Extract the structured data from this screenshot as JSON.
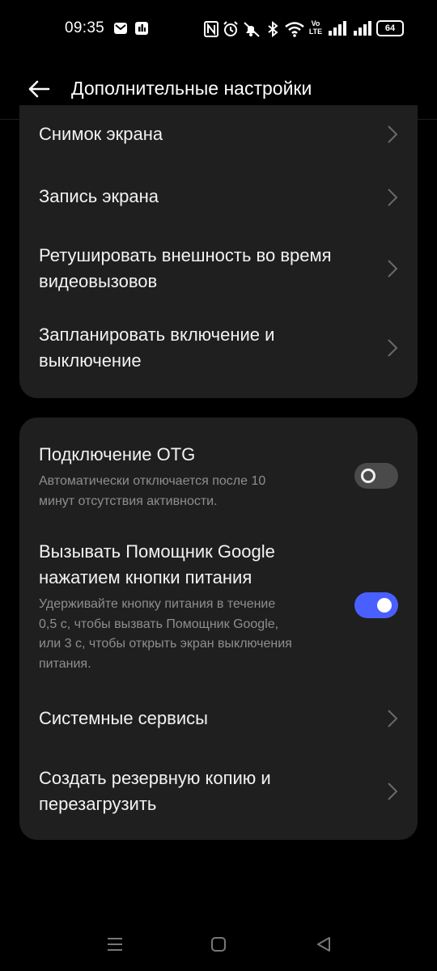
{
  "status_bar": {
    "time": "09:35",
    "battery": "64",
    "icons": [
      "mail-icon",
      "app-notification-icon",
      "nfc-icon",
      "alarm-icon",
      "mute-icon",
      "bluetooth-icon",
      "wifi-icon",
      "volte-icon",
      "signal-icon",
      "signal-2-icon",
      "battery-icon"
    ],
    "volte_label_top": "Vo",
    "volte_label_bottom": "LTE"
  },
  "header": {
    "title": "Дополнительные настройки",
    "back_icon": "arrow-left-icon"
  },
  "section1": {
    "items": [
      {
        "label": "Снимок экрана"
      },
      {
        "label": "Запись экрана"
      },
      {
        "label_line1": "Ретушировать внешность во время",
        "label_line2": "видеовызовов"
      },
      {
        "label_line1": "Запланировать включение и",
        "label_line2": "выключение"
      }
    ]
  },
  "section2": {
    "otg": {
      "title": "Подключение OTG",
      "subtitle_line1": "Автоматически отключается после 10",
      "subtitle_line2": "минут отсутствия активности.",
      "enabled": false
    },
    "google": {
      "title_line1": "Вызывать Помощник Google",
      "title_line2": "нажатием кнопки питания",
      "subtitle_line1": "Удерживайте кнопку питания в течение",
      "subtitle_line2": "0,5 с, чтобы вызвать Помощник Google,",
      "subtitle_line3": "или 3 с, чтобы открыть экран выключения",
      "subtitle_line4": "питания.",
      "enabled": true
    },
    "system_services": {
      "label": "Системные сервисы"
    },
    "backup": {
      "label_line1": "Создать резервную копию и",
      "label_line2": "перезагрузить"
    }
  },
  "colors": {
    "background": "#000000",
    "card": "#1f1f1f",
    "accent": "#4a5fff",
    "subtitle": "#8e8e8e"
  },
  "navbar": {
    "icons": [
      "menu-icon",
      "home-icon",
      "back-triangle-icon"
    ]
  }
}
